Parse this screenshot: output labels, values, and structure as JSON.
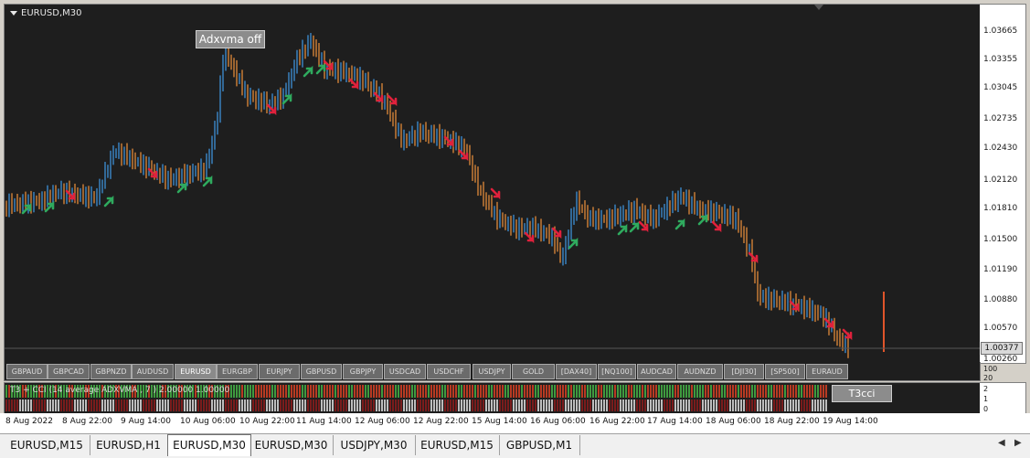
{
  "chart": {
    "title": "EURUSD,M30",
    "overlay_button": "Adxvma off",
    "price_labels": [
      "1.03665",
      "1.03355",
      "1.03045",
      "1.02735",
      "1.02430",
      "1.02120",
      "1.01810",
      "1.01500",
      "1.01190",
      "1.00880",
      "1.00570",
      "1.00260"
    ],
    "current_price": "1.00377"
  },
  "symbols": [
    "GBPAUD",
    "GBPCAD",
    "GBPNZD",
    "AUDUSD",
    "EURUSD",
    "EURGBP",
    "EURJPY",
    "GBPUSD",
    "GBPJPY",
    "USDCAD",
    "USDCHF",
    "USDJPY",
    "GOLD",
    "[DAX40]",
    "[NQ100]",
    "AUDCAD",
    "AUDNZD",
    "[DJI30]",
    "[SP500]",
    "EURAUD"
  ],
  "indicator": {
    "title": "T3 + CCI (14 average ADXVMA , 7 ) 2.00000 1.00000",
    "button": "T3cci",
    "axis_labels": [
      "100",
      "20",
      "2",
      "1",
      "0"
    ]
  },
  "time_labels": [
    "8 Aug 2022",
    "8 Aug 22:00",
    "9 Aug 14:00",
    "10 Aug 06:00",
    "10 Aug 22:00",
    "11 Aug 14:00",
    "12 Aug 06:00",
    "12 Aug 22:00",
    "15 Aug 14:00",
    "16 Aug 06:00",
    "16 Aug 22:00",
    "17 Aug 14:00",
    "18 Aug 06:00",
    "18 Aug 22:00",
    "19 Aug 14:00"
  ],
  "tabs": [
    "EURUSD,M15",
    "EURUSD,H1",
    "EURUSD,M30",
    "EURUSD,M30",
    "USDJPY,M30",
    "EURUSD,M15",
    "GBPUSD,M1"
  ],
  "active_tab_index": 2,
  "colors": {
    "bull": "#3d8fd6",
    "bear": "#e0893a",
    "buy_arrow": "#2faa5e",
    "sell_arrow": "#e0213c",
    "ind_green": "#3f9a3f",
    "ind_red": "#b83a22"
  }
}
